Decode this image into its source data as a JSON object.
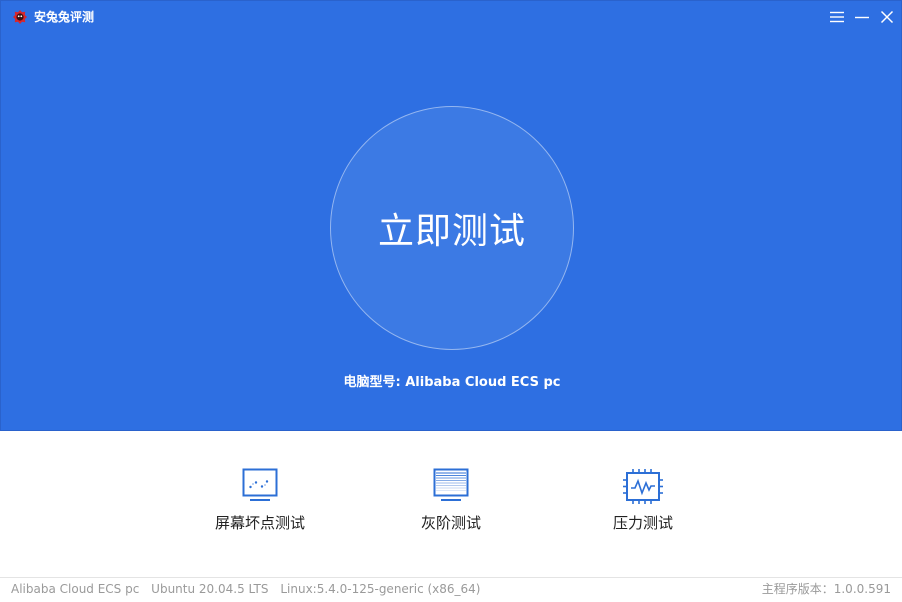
{
  "app": {
    "title": "安兔兔评测"
  },
  "hero": {
    "start_button": "立即测试",
    "model_label": "电脑型号:",
    "model_value": "Alibaba Cloud ECS pc"
  },
  "tools": [
    {
      "label": "屏幕坏点测试",
      "icon": "dead-pixel-monitor-icon"
    },
    {
      "label": "灰阶测试",
      "icon": "grayscale-monitor-icon"
    },
    {
      "label": "压力测试",
      "icon": "cpu-chip-icon"
    }
  ],
  "status": {
    "model": "Alibaba Cloud ECS pc",
    "os": "Ubuntu 20.04.5 LTS",
    "kernel": "Linux:5.4.0-125-generic (x86_64)",
    "version_label": "主程序版本：",
    "version_value": "1.0.0.591"
  },
  "colors": {
    "hero_bg": "#2e6fe2",
    "circle_bg": "#3c7ae4",
    "icon_blue": "#2c6fd6"
  }
}
